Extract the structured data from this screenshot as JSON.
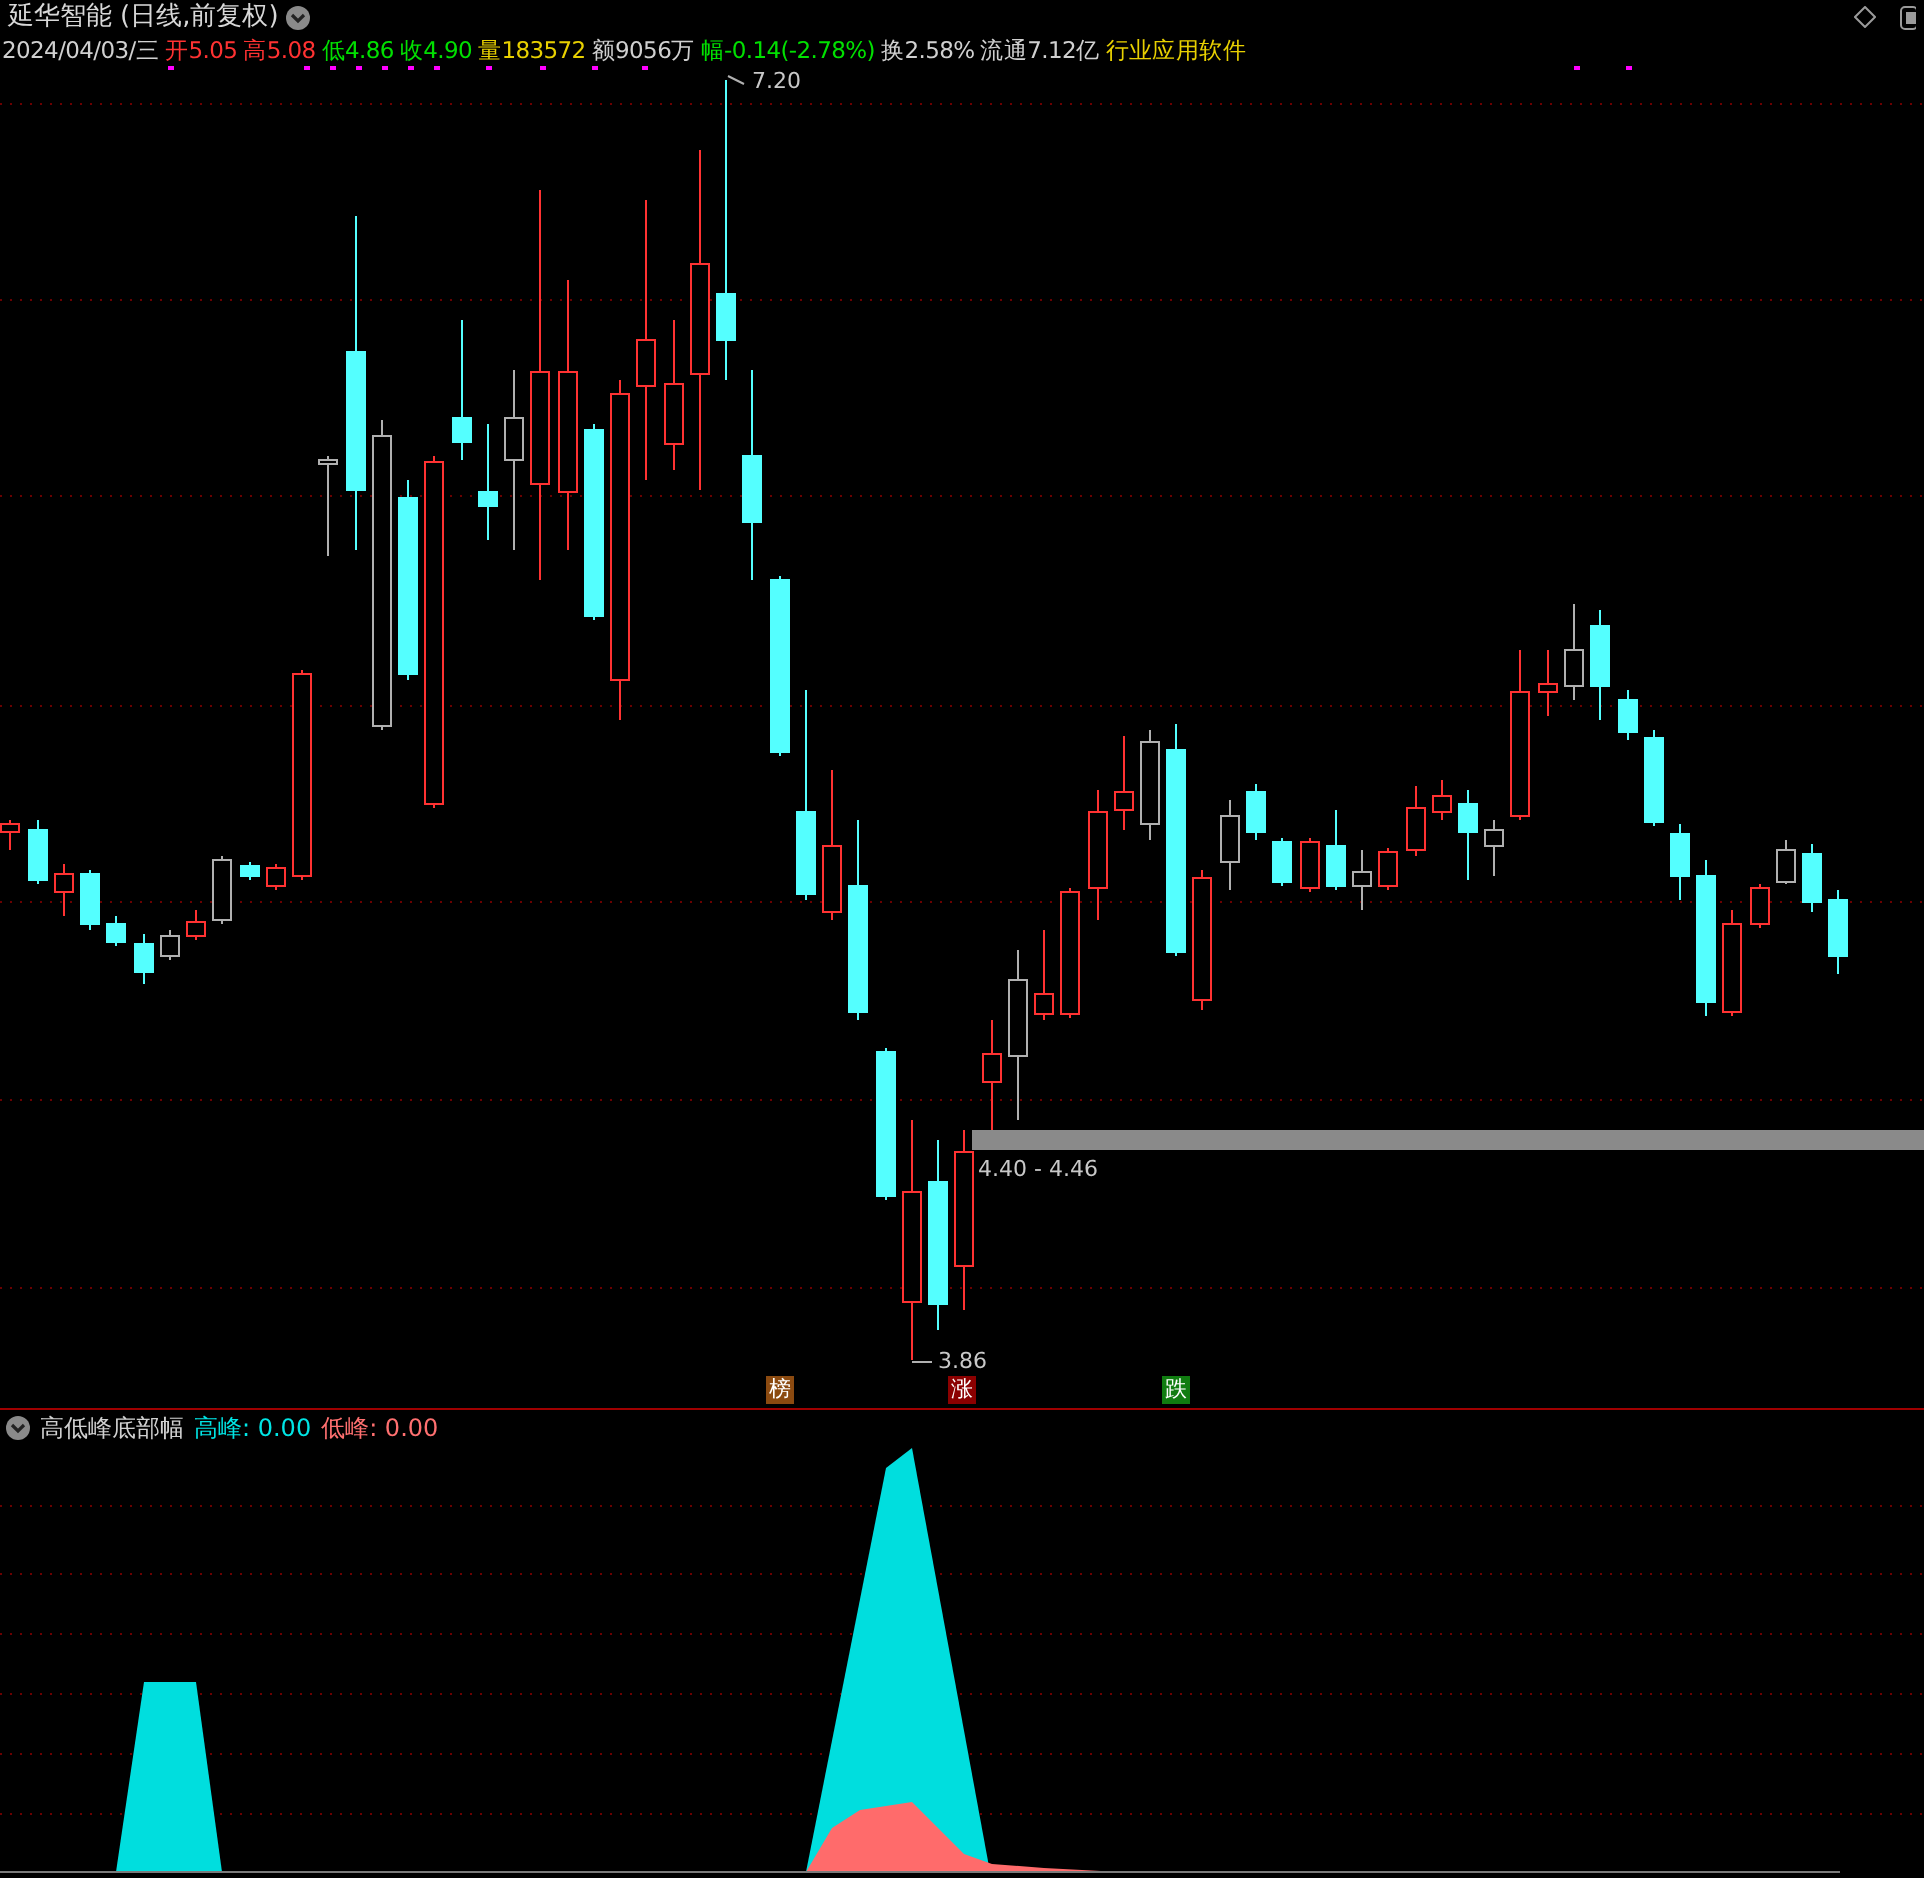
{
  "title": {
    "name": "延华智能",
    "period": "(日线,前复权)"
  },
  "quote": [
    {
      "text": "2024/04/03/三",
      "color": "#d0d0d0"
    },
    {
      "text": "开5.05",
      "color": "#ff3232"
    },
    {
      "text": "高5.08",
      "color": "#ff3232"
    },
    {
      "text": "低4.86",
      "color": "#00e000"
    },
    {
      "text": "收4.90",
      "color": "#00e000"
    },
    {
      "text": "量183572",
      "color": "#e8d000"
    },
    {
      "text": "额9056万",
      "color": "#d0d0d0"
    },
    {
      "text": "幅-0.14(-2.78%)",
      "color": "#00e000"
    },
    {
      "text": "换2.58%",
      "color": "#d0d0d0"
    },
    {
      "text": "流通7.12亿",
      "color": "#d0d0d0"
    },
    {
      "text": "行业应用软件",
      "color": "#e8d000"
    }
  ],
  "price_labels": {
    "high": "7.20",
    "low": "3.86",
    "range": "4.40 - 4.46"
  },
  "tags": [
    {
      "text": "榜",
      "color": "#8b4a10"
    },
    {
      "text": "涨",
      "color": "#8b0000"
    },
    {
      "text": "跌",
      "color": "#107c10"
    }
  ],
  "indicator": {
    "name": "高低峰底部幅",
    "values": [
      {
        "text": "高峰: 0.00",
        "color": "#00e5e5"
      },
      {
        "text": "低峰: 0.00",
        "color": "#ff7070"
      }
    ]
  }
}
